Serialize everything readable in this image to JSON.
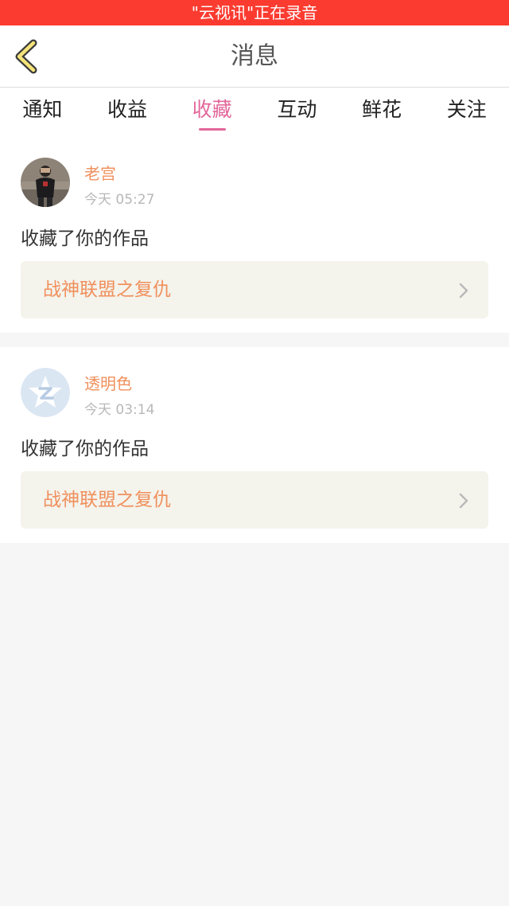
{
  "status_bar": {
    "text": "\"云视讯\"正在录音"
  },
  "header": {
    "title": "消息",
    "back_icon": "chevron-left-icon"
  },
  "tabs": [
    {
      "label": "通知",
      "active": false
    },
    {
      "label": "收益",
      "active": false
    },
    {
      "label": "收藏",
      "active": true
    },
    {
      "label": "互动",
      "active": false
    },
    {
      "label": "鲜花",
      "active": false
    },
    {
      "label": "关注",
      "active": false
    }
  ],
  "messages": [
    {
      "user": "老宫",
      "time": "今天 05:27",
      "action": "收藏了你的作品",
      "work_title": "战神联盟之复仇",
      "avatar": "photo-avatar"
    },
    {
      "user": "透明色",
      "time": "今天 03:14",
      "action": "收藏了你的作品",
      "work_title": "战神联盟之复仇",
      "avatar": "default-qq-avatar"
    }
  ],
  "colors": {
    "status_bar": "#fb3b30",
    "accent_pink": "#e2679a",
    "accent_orange": "#f0905c",
    "back_icon": "#f5e37a"
  }
}
